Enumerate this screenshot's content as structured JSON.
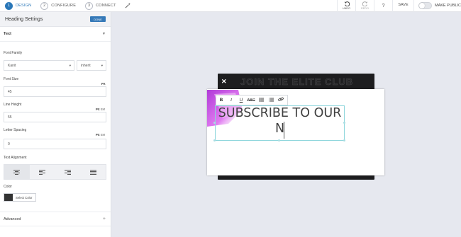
{
  "topbar": {
    "steps": [
      {
        "num": "1",
        "label": "DESIGN",
        "active": true
      },
      {
        "num": "2",
        "label": "CONFIGURE",
        "active": false
      },
      {
        "num": "3",
        "label": "CONNECT",
        "active": false
      }
    ],
    "undo_label": "UNDO",
    "redo_label": "REDO",
    "help_label": "?",
    "save_label": "SAVE",
    "make_public_label": "MAKE PUBLIC",
    "make_public_on": false,
    "accent_color": "#2a77b8"
  },
  "panel": {
    "title": "Heading Settings",
    "done_label": "DONE",
    "text_section": "Text",
    "font_family_label": "Font Family",
    "font_family_value": "Kanit",
    "font_weight_value": "inherit",
    "font_size_label": "Font Size",
    "font_size_unit": "PX",
    "font_size_value": "45",
    "line_height_label": "Line Height",
    "line_height_unit_px": "PX",
    "line_height_unit_em": "EM",
    "line_height_value": "55",
    "letter_spacing_label": "Letter Spacing",
    "letter_spacing_unit_px": "PX",
    "letter_spacing_unit_em": "EM",
    "letter_spacing_value": "0",
    "text_alignment_label": "Text Alignment",
    "alignment_options": [
      "center",
      "left",
      "right",
      "justify"
    ],
    "alignment_selected": "center",
    "color_label": "Color",
    "color_button_label": "Select Color",
    "color_value": "#333333",
    "advanced_label": "Advanced"
  },
  "canvas": {
    "background_title": "JOIN THE ELITE CLUB",
    "heading_line1": "SUBSCRIBE TO OUR",
    "heading_line2": "N",
    "toolbar_buttons": [
      "B",
      "I",
      "U",
      "ABC"
    ]
  }
}
